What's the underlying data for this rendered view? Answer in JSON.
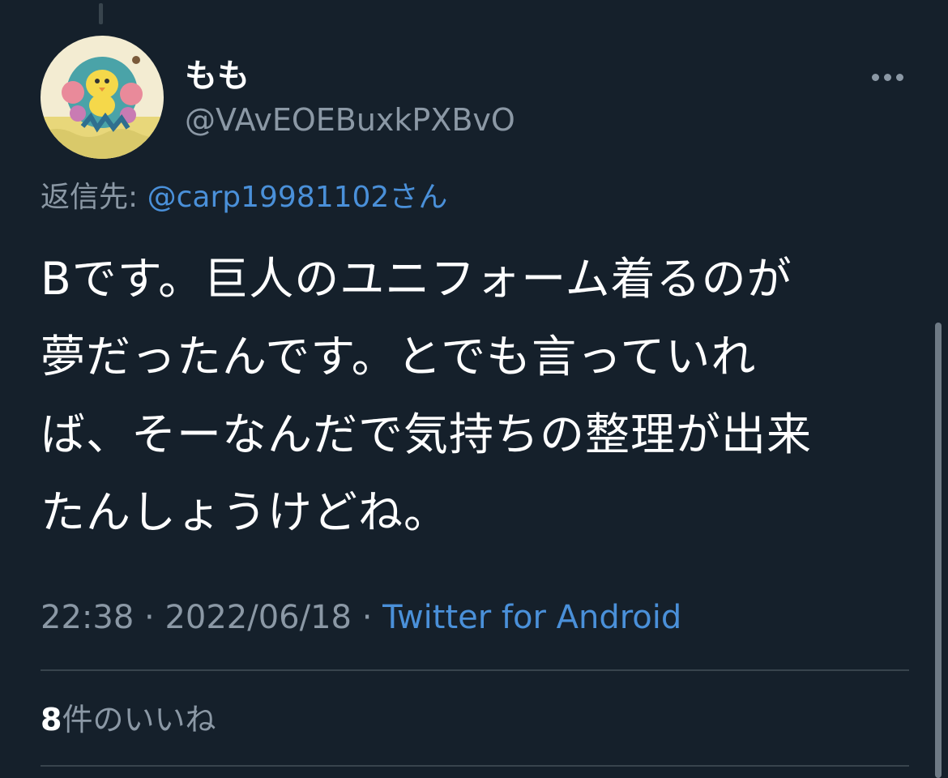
{
  "tweet": {
    "display_name": "もも",
    "handle": "@VAvEOEBuxkPXBvO",
    "reply_prefix": "返信先:",
    "reply_mention": "@carp19981102",
    "reply_suffix": "さん",
    "text_lines": [
      "Bです。巨人のユニフォーム着るのが",
      "夢だったんです。とでも言っていれ",
      "ば、そーなんだで気持ちの整理が出来",
      "たんしょうけどね。"
    ],
    "time": "22:38",
    "separator": "·",
    "date": "2022/06/18",
    "source": "Twitter for Android",
    "likes_count": "8",
    "likes_label": "件のいいね"
  },
  "icons": {
    "more": "more-horizontal-icon",
    "avatar": "user-avatar"
  },
  "colors": {
    "background": "#15202b",
    "accent": "#4a90d9",
    "muted_text": "#8b98a5",
    "divider": "#38444d"
  }
}
